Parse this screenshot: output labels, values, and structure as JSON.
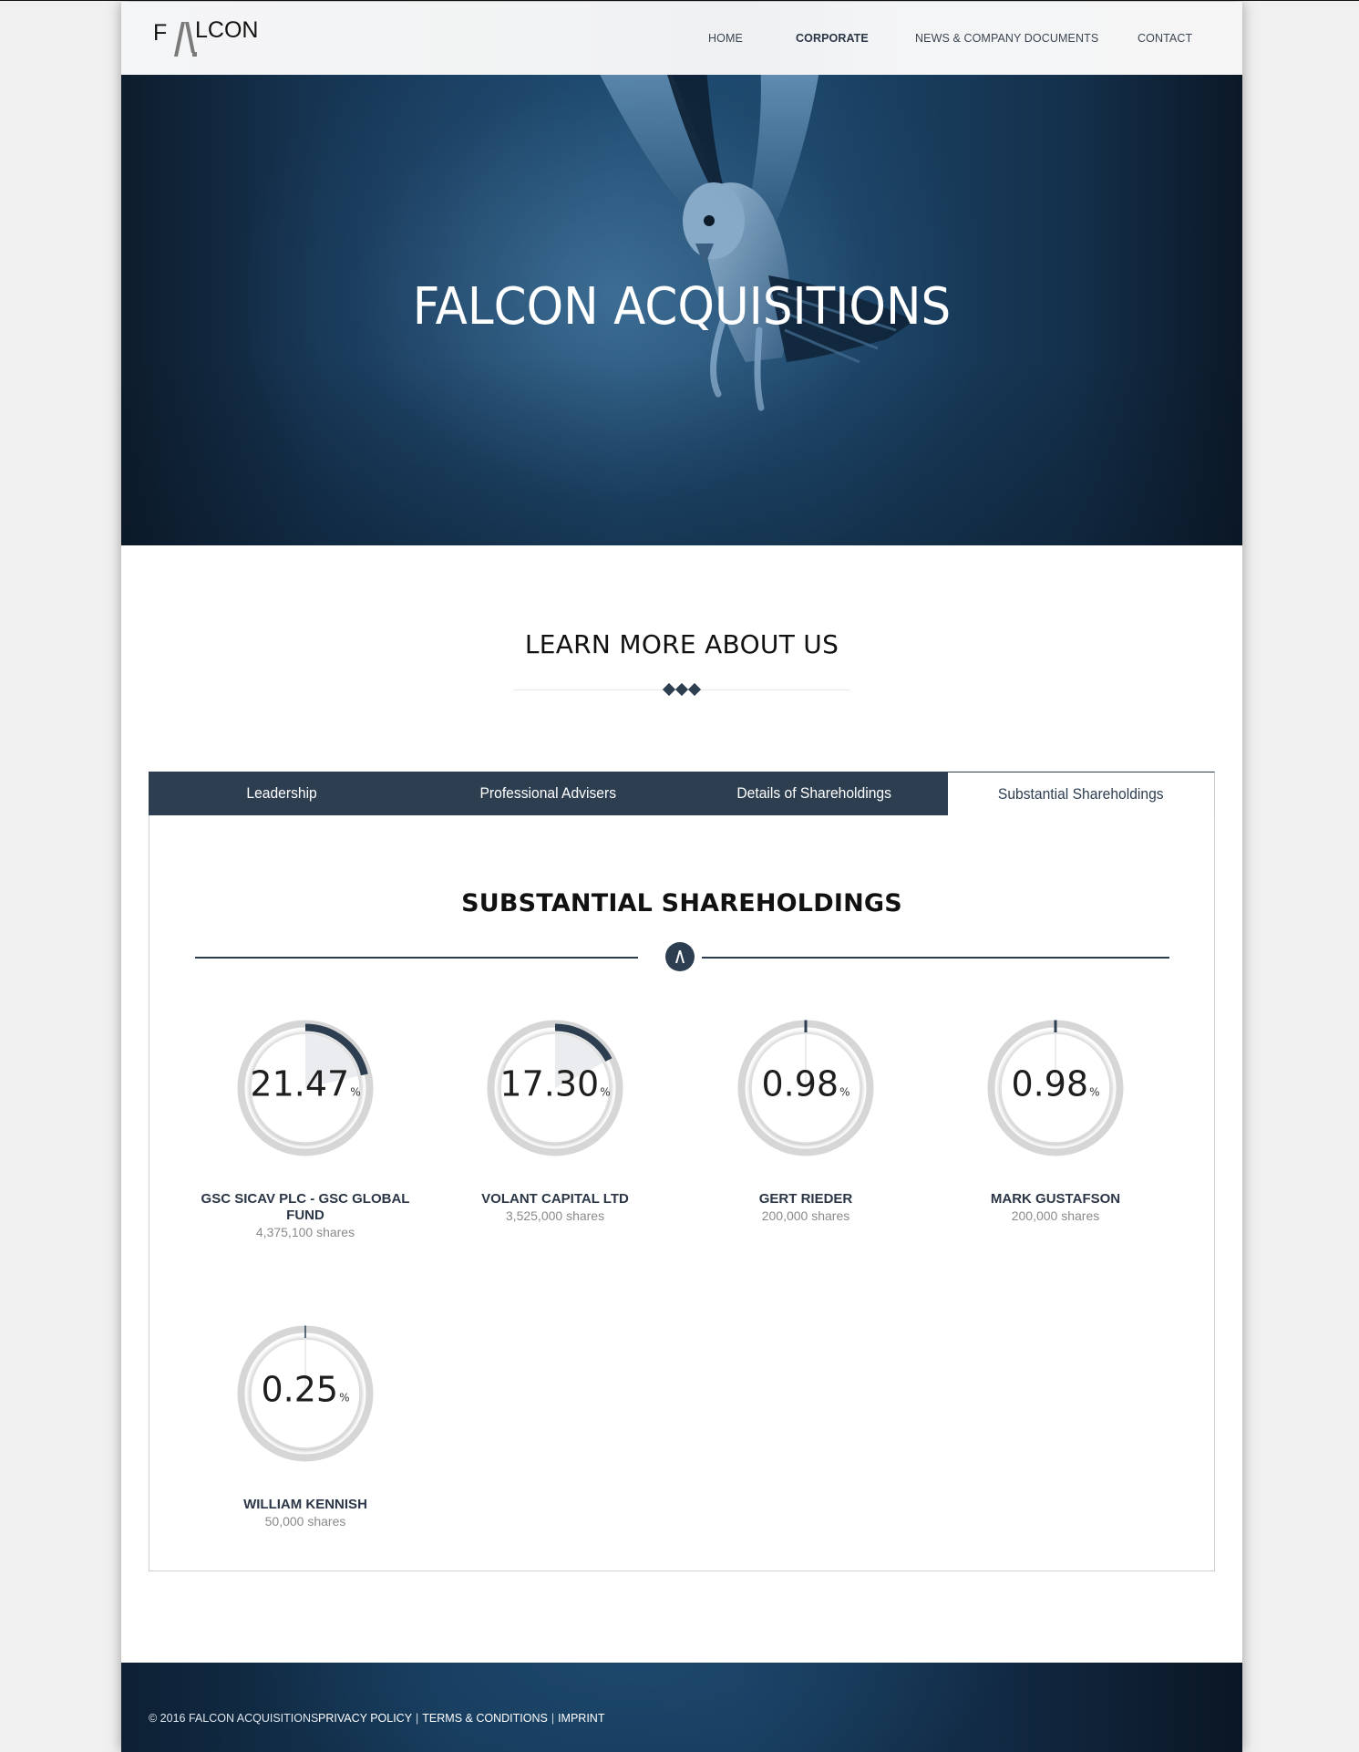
{
  "header": {
    "logo_text": "FALCON",
    "nav": [
      {
        "label": "HOME",
        "active": false
      },
      {
        "label": "CORPORATE",
        "active": true
      },
      {
        "label": "NEWS & COMPANY DOCUMENTS",
        "active": false
      },
      {
        "label": "CONTACT",
        "active": false
      }
    ]
  },
  "hero": {
    "title": "FALCON ACQUISITIONS"
  },
  "about": {
    "title": "LEARN MORE ABOUT US"
  },
  "tabs": [
    {
      "label": "Leadership",
      "active": false
    },
    {
      "label": "Professional Advisers",
      "active": false
    },
    {
      "label": "Details of Shareholdings",
      "active": false
    },
    {
      "label": "Substantial Shareholdings",
      "active": true
    }
  ],
  "panel": {
    "title": "SUBSTANTIAL SHAREHOLDINGS",
    "badge_icon": "falcon-logo-mark",
    "percent_suffix": "%",
    "holders": [
      {
        "name": "GSC SICAV PLC - GSC GLOBAL FUND",
        "percent": 21.47,
        "percent_label": "21.47",
        "shares": "4,375,100 shares"
      },
      {
        "name": "VOLANT CAPITAL LTD",
        "percent": 17.3,
        "percent_label": "17.30",
        "shares": "3,525,000 shares"
      },
      {
        "name": "GERT RIEDER",
        "percent": 0.98,
        "percent_label": "0.98",
        "shares": "200,000 shares"
      },
      {
        "name": "MARK GUSTAFSON",
        "percent": 0.98,
        "percent_label": "0.98",
        "shares": "200,000 shares"
      },
      {
        "name": "WILLIAM KENNISH",
        "percent": 0.25,
        "percent_label": "0.25",
        "shares": "50,000 shares"
      }
    ]
  },
  "colors": {
    "brand_dark": "#2d3e50",
    "ring_gray": "#d6d6d6",
    "wedge_light": "#ebecef"
  },
  "footer": {
    "copyright": "© 2016 FALCON ACQUISITIONS",
    "links": [
      "PRIVACY POLICY",
      "TERMS & CONDITIONS",
      "IMPRINT"
    ],
    "separator": "|"
  }
}
